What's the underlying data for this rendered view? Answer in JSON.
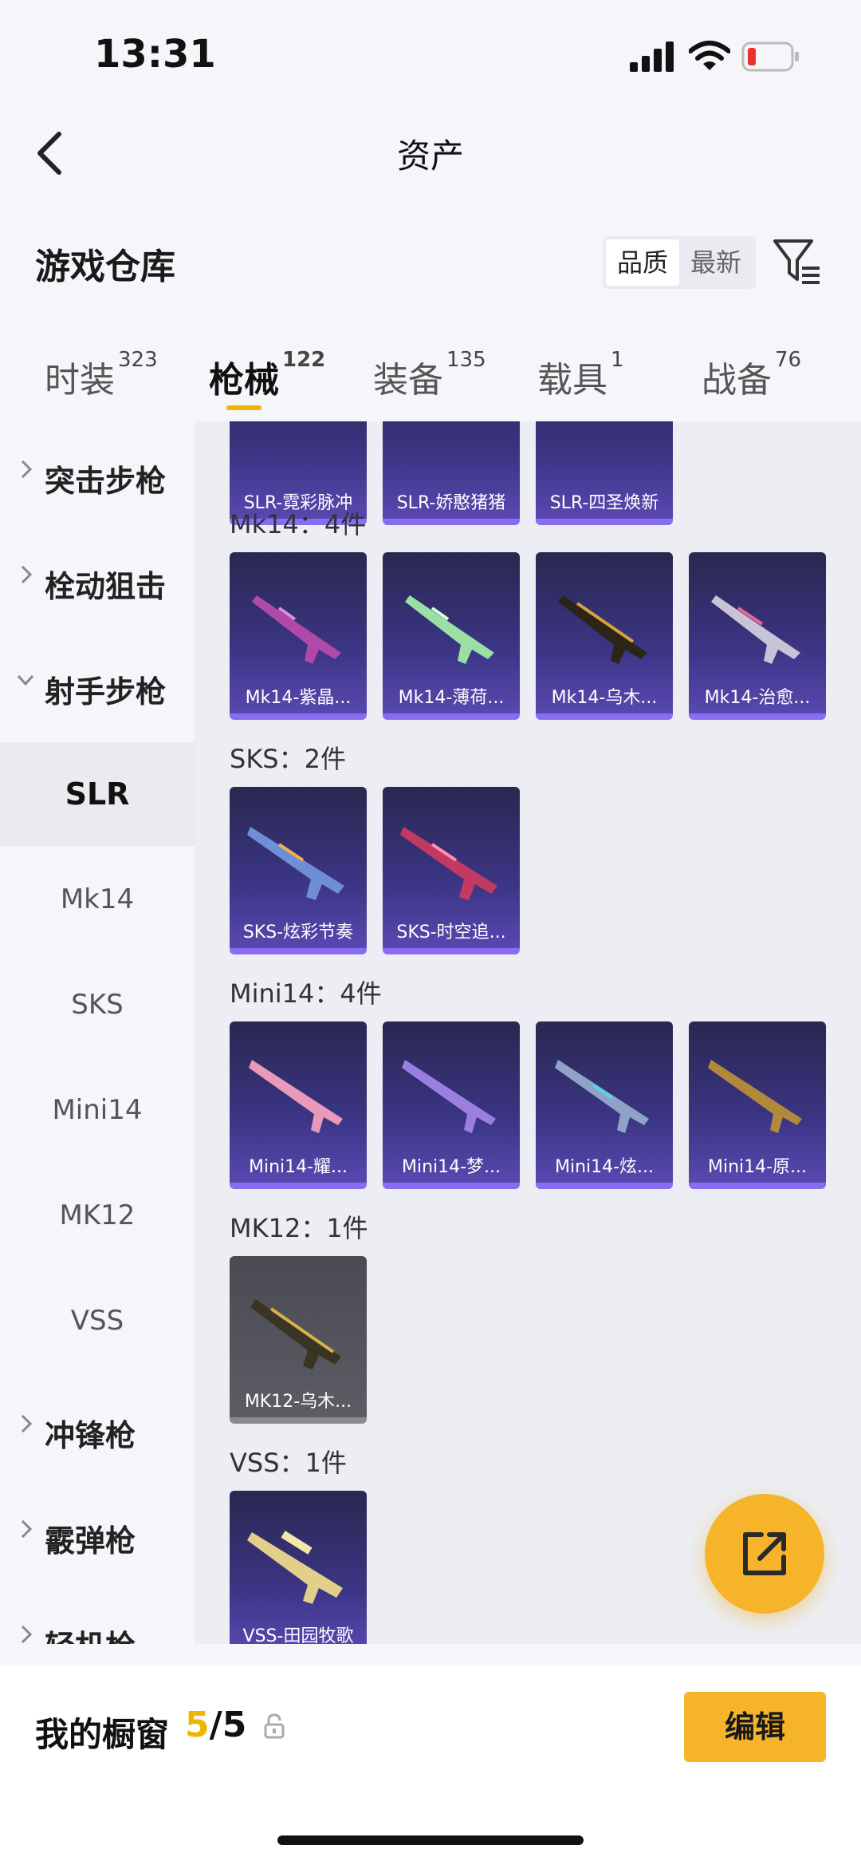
{
  "status_bar": {
    "time": "13:31"
  },
  "header": {
    "title": "资产"
  },
  "section": {
    "title": "游戏仓库",
    "sort_options": [
      "品质",
      "最新"
    ]
  },
  "tabs": [
    {
      "label": "时装",
      "count": "323"
    },
    {
      "label": "枪械",
      "count": "122"
    },
    {
      "label": "装备",
      "count": "135"
    },
    {
      "label": "载具",
      "count": "1"
    },
    {
      "label": "战备",
      "count": "76"
    }
  ],
  "sidebar": {
    "categories": [
      "突击步枪",
      "栓动狙击",
      "射手步枪",
      "冲锋枪",
      "霰弹枪",
      "轻机枪"
    ],
    "sub_items": [
      "SLR",
      "Mk14",
      "SKS",
      "Mini14",
      "MK12",
      "VSS"
    ]
  },
  "content": {
    "slr_items": [
      "SLR-霓彩脉冲",
      "SLR-娇憨猪猪",
      "SLR-四圣焕新"
    ],
    "groups": [
      {
        "label": "Mk14：4件",
        "items": [
          "Mk14-紫晶...",
          "Mk14-薄荷...",
          "Mk14-乌木...",
          "Mk14-治愈..."
        ]
      },
      {
        "label": "SKS：2件",
        "items": [
          "SKS-炫彩节奏",
          "SKS-时空追..."
        ]
      },
      {
        "label": "Mini14：4件",
        "items": [
          "Mini14-耀...",
          "Mini14-梦...",
          "Mini14-炫...",
          "Mini14-原..."
        ]
      },
      {
        "label": "MK12：1件",
        "items": [
          "MK12-乌木..."
        ]
      },
      {
        "label": "VSS：1件",
        "items": [
          "VSS-田园牧歌"
        ]
      }
    ]
  },
  "bottom_bar": {
    "showcase_label": "我的橱窗",
    "count_current": "5",
    "count_total": "/5",
    "edit_label": "编辑"
  }
}
